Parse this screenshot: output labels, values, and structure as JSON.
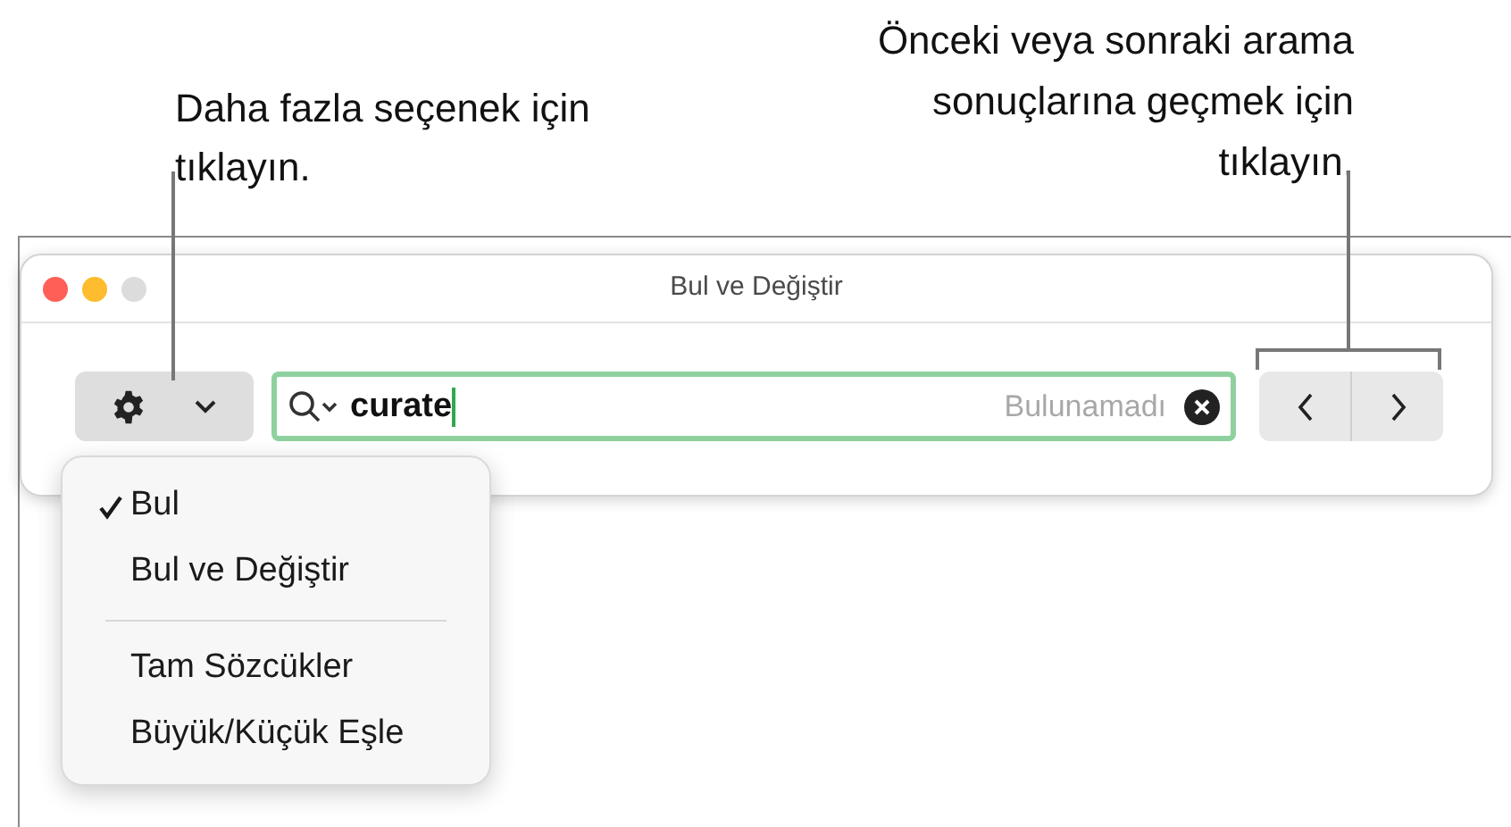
{
  "callouts": [
    {
      "text": "Daha fazla seçenek için tıklayın."
    },
    {
      "text": "Önceki veya sonraki arama sonuçlarına geçmek için tıklayın."
    }
  ],
  "window": {
    "title": "Bul ve Değiştir"
  },
  "search": {
    "value": "curate",
    "status": "Bulunamadı"
  },
  "menu": {
    "groups": [
      [
        {
          "label": "Bul",
          "checked": true
        },
        {
          "label": "Bul ve Değiştir",
          "checked": false
        }
      ],
      [
        {
          "label": "Tam Sözcükler",
          "checked": false
        },
        {
          "label": "Büyük/Küçük Eşle",
          "checked": false
        }
      ]
    ]
  }
}
